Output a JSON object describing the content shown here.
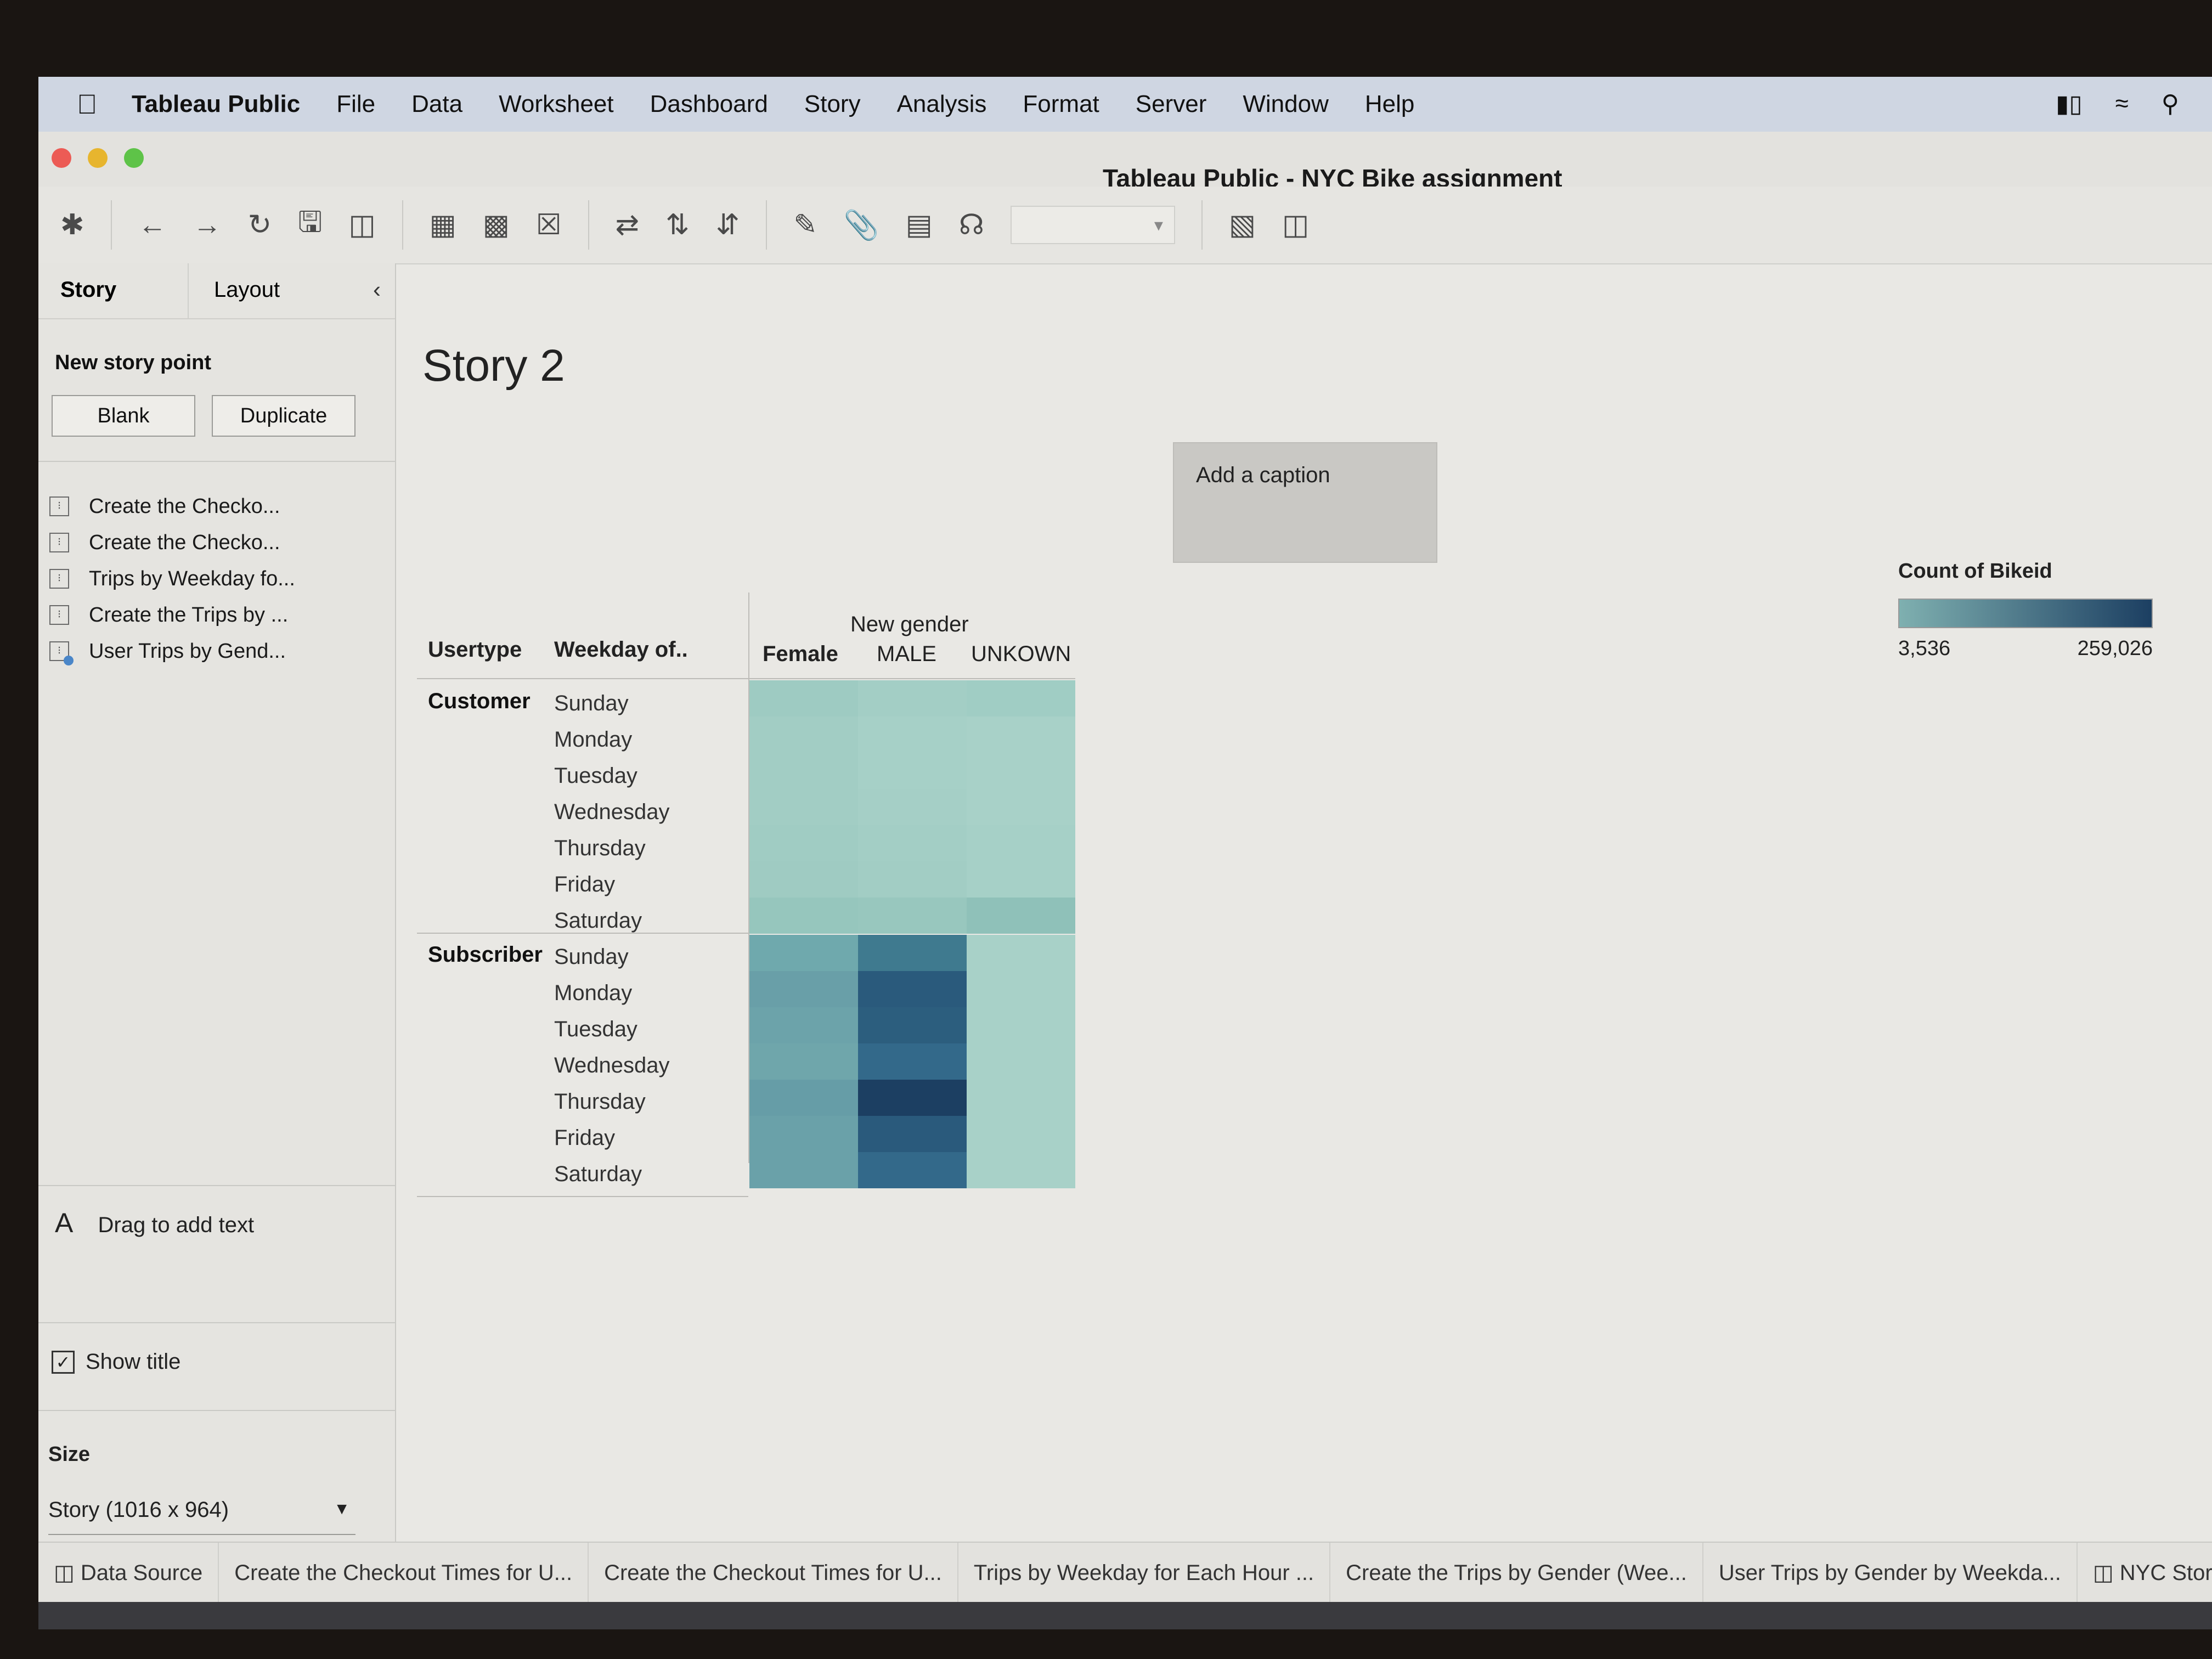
{
  "menubar": {
    "app": "Tableau Public",
    "items": [
      "File",
      "Data",
      "Worksheet",
      "Dashboard",
      "Story",
      "Analysis",
      "Format",
      "Server",
      "Window",
      "Help"
    ]
  },
  "window": {
    "title": "Tableau Public - NYC Bike assignment"
  },
  "panel": {
    "tab_story": "Story",
    "tab_layout": "Layout",
    "new_story_point": "New story point",
    "blank": "Blank",
    "duplicate": "Duplicate",
    "sheets": [
      "Create the Checko...",
      "Create the Checko...",
      "Trips by Weekday fo...",
      "Create the Trips by ...",
      "User Trips by Gend..."
    ],
    "drag_text": "Drag to add text",
    "show_title": "Show title",
    "size_label": "Size",
    "size_value": "Story (1016 x 964)"
  },
  "story": {
    "title": "Story 2",
    "caption": "Add a caption"
  },
  "crosstab": {
    "column_group": "New gender",
    "row_header_1": "Usertype",
    "row_header_2": "Weekday of..",
    "columns": [
      "Female",
      "MALE",
      "UNKOWN"
    ],
    "groups": [
      {
        "name": "Customer",
        "days": [
          "Sunday",
          "Monday",
          "Tuesday",
          "Wednesday",
          "Thursday",
          "Friday",
          "Saturday"
        ]
      },
      {
        "name": "Subscriber",
        "days": [
          "Sunday",
          "Monday",
          "Tuesday",
          "Wednesday",
          "Thursday",
          "Friday",
          "Saturday"
        ]
      }
    ],
    "cell_colors": [
      [
        "#9ecbc2",
        "#a3cec5",
        "#a0cdc4"
      ],
      [
        "#a2cdc4",
        "#a6d0c7",
        "#a8d1c8"
      ],
      [
        "#a2cdc4",
        "#a6d0c7",
        "#a8d1c8"
      ],
      [
        "#a2cdc4",
        "#a5cfc6",
        "#a8d1c8"
      ],
      [
        "#a0ccc3",
        "#a3cec5",
        "#a6d0c7"
      ],
      [
        "#9fcbc2",
        "#a2cdc4",
        "#a6d0c7"
      ],
      [
        "#96c6bd",
        "#98c7be",
        "#8fc1b9"
      ],
      [
        "#6fa9ad",
        "#3f7a8f",
        "#a8d1c8"
      ],
      [
        "#699fa8",
        "#2a5a7c",
        "#a8d1c8"
      ],
      [
        "#6ca3aa",
        "#2c5e7e",
        "#a8d1c8"
      ],
      [
        "#6fa6ab",
        "#33698a",
        "#a8d1c8"
      ],
      [
        "#669da7",
        "#1c3f62",
        "#a8d1c8"
      ],
      [
        "#6aa1a9",
        "#2a5a7c",
        "#a8d1c8"
      ],
      [
        "#6aa1a9",
        "#33698a",
        "#a8d1c8"
      ]
    ]
  },
  "legend": {
    "title": "Count of Bikeid",
    "min": "3,536",
    "max": "259,026",
    "color_low": "#7fb0b0",
    "color_high": "#1c3f62"
  },
  "bottom_tabs": [
    "Data Source",
    "Create the Checkout Times for U...",
    "Create the Checkout Times for U...",
    "Trips by Weekday for Each Hour ...",
    "Create the Trips by Gender (Wee...",
    "User Trips by Gender by Weekda...",
    "NYC Story"
  ]
}
